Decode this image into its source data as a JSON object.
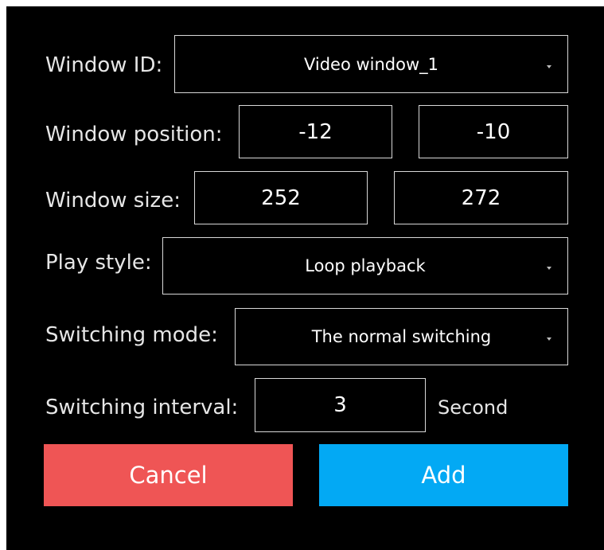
{
  "form": {
    "window_id": {
      "label": "Window ID:",
      "value": "Video window_1"
    },
    "window_position": {
      "label": "Window position:",
      "x": "-12",
      "y": "-10"
    },
    "window_size": {
      "label": "Window size:",
      "width": "252",
      "height": "272"
    },
    "play_style": {
      "label": "Play style:",
      "value": "Loop playback"
    },
    "switching_mode": {
      "label": "Switching mode:",
      "value": "The normal switching"
    },
    "switching_interval": {
      "label": "Switching interval:",
      "value": "3",
      "unit": "Second"
    }
  },
  "buttons": {
    "cancel": "Cancel",
    "add": "Add"
  },
  "colors": {
    "background": "#000000",
    "cancel": "#ef5555",
    "add": "#03a9f4"
  },
  "icons": {
    "dropdown": "chevron-down-icon"
  }
}
